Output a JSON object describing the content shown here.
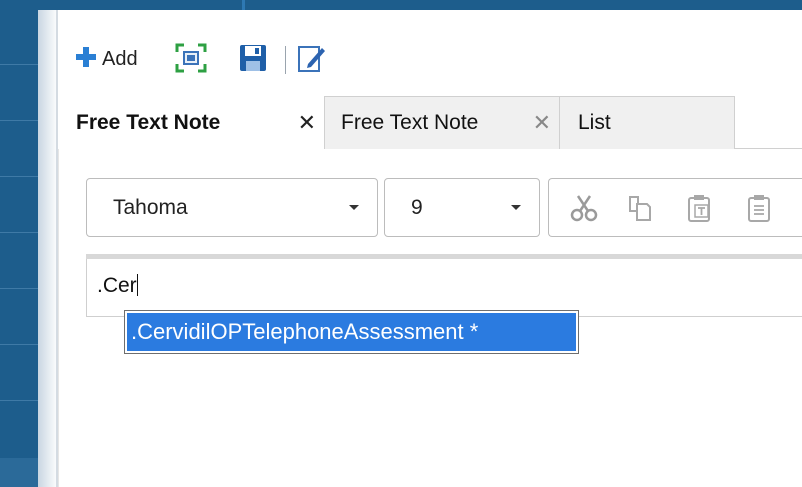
{
  "toolbar": {
    "add_label": "Add"
  },
  "tabs": [
    {
      "label": "Free Text Note",
      "close": "✕",
      "active": true
    },
    {
      "label": "Free Text Note",
      "close": "✕",
      "active": false
    },
    {
      "label": "List",
      "active": false
    }
  ],
  "format_bar": {
    "font_family_value": "Tahoma",
    "font_size_value": "9",
    "icons": [
      "cut-icon",
      "copy-icon",
      "paste-text-icon",
      "paste-icon"
    ]
  },
  "editor": {
    "text": ".Cer"
  },
  "autocomplete": {
    "items": [
      ".CervidilOPTelephoneAssessment *"
    ]
  },
  "colors": {
    "rail": "#1d5d8c",
    "selection": "#2b7be0",
    "add_icon": "#2a7fd4"
  }
}
